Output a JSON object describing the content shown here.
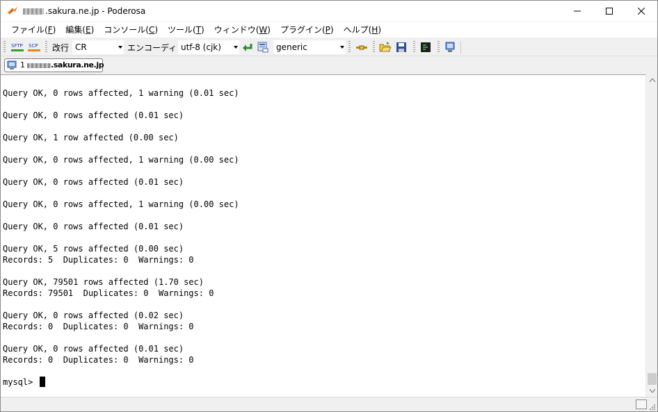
{
  "window": {
    "title_suffix": ".sakura.ne.jp - Poderosa",
    "title_prefix_redacted": "xxxx"
  },
  "menu": [
    {
      "label": "ファイル(",
      "accel": "F",
      "end": ")"
    },
    {
      "label": "編集(",
      "accel": "E",
      "end": ")"
    },
    {
      "label": "コンソール(",
      "accel": "C",
      "end": ")"
    },
    {
      "label": "ツール(",
      "accel": "T",
      "end": ")"
    },
    {
      "label": "ウィンドウ(",
      "accel": "W",
      "end": ")"
    },
    {
      "label": "プラグイン(",
      "accel": "P",
      "end": ")"
    },
    {
      "label": "ヘルプ(",
      "accel": "H",
      "end": ")"
    }
  ],
  "toolbar": {
    "sftp_label": "SFTP",
    "scp_label": "SCP",
    "newline_label": "改行",
    "newline_value": "CR",
    "encoding_label": "エンコーディング",
    "encoding_value": "utf-8 (cjk)",
    "terminal_type_value": "generic",
    "icons": [
      "sftp-icon",
      "scp-icon",
      "newline-icon",
      "encoding-icon",
      "line-feed-icon",
      "terminal-settings-icon",
      "fork-icon",
      "open-folder-icon",
      "save-icon",
      "broadcast-icon",
      "log-icon"
    ]
  },
  "tab": {
    "index": "1",
    "host_suffix": ".sakura.ne.jp"
  },
  "terminal": {
    "lines": [
      "Query OK, 0 rows affected, 1 warning (0.01 sec)",
      "",
      "Query OK, 0 rows affected (0.01 sec)",
      "",
      "Query OK, 1 row affected (0.00 sec)",
      "",
      "Query OK, 0 rows affected, 1 warning (0.00 sec)",
      "",
      "Query OK, 0 rows affected (0.01 sec)",
      "",
      "Query OK, 0 rows affected, 1 warning (0.00 sec)",
      "",
      "Query OK, 0 rows affected (0.01 sec)",
      "",
      "Query OK, 5 rows affected (0.00 sec)",
      "Records: 5  Duplicates: 0  Warnings: 0",
      "",
      "Query OK, 79501 rows affected (1.70 sec)",
      "Records: 79501  Duplicates: 0  Warnings: 0",
      "",
      "Query OK, 0 rows affected (0.02 sec)",
      "Records: 0  Duplicates: 0  Warnings: 0",
      "",
      "Query OK, 0 rows affected (0.01 sec)",
      "Records: 0  Duplicates: 0  Warnings: 0",
      ""
    ],
    "prompt": "mysql> ",
    "scroll_position": 1.0
  },
  "colors": {
    "terminal_bg": "#ffffff",
    "terminal_fg": "#000000",
    "chrome_bg": "#f0f0f0"
  }
}
